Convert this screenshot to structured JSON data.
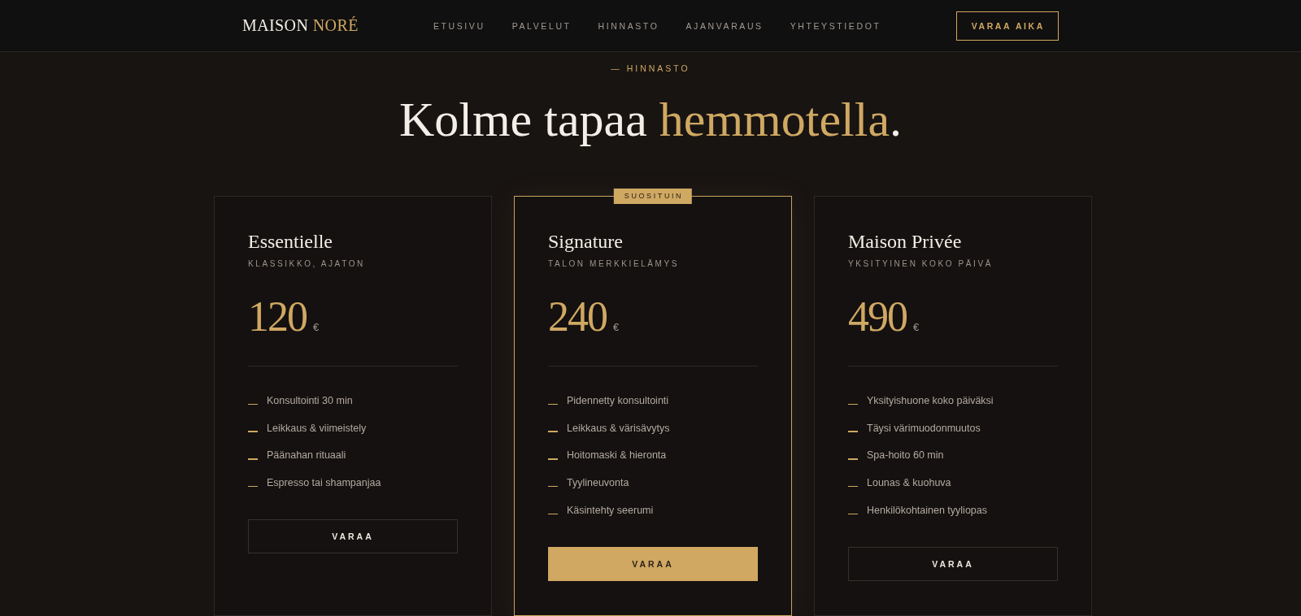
{
  "header": {
    "logo": {
      "text": "MAISON",
      "accent": "NORÉ"
    },
    "nav": [
      "ETUSIVU",
      "PALVELUT",
      "HINNASTO",
      "AJANVARAUS",
      "YHTEYSTIEDOT"
    ],
    "cta": "VARAA AIKA"
  },
  "pricing": {
    "eyebrow": "— HINNASTO",
    "heading": {
      "lead": "Kolme tapaa",
      "accent": "hemmotella",
      "tail": "."
    },
    "plans": [
      {
        "name": "Essentielle",
        "tagline": "KLASSIKKO, AJATON",
        "price": "120",
        "currency": "€",
        "features": [
          "Konsultointi 30 min",
          "Leikkaus & viimeistely",
          "Päänahan rituaali",
          "Espresso tai shampanjaa"
        ],
        "button": "VARAA",
        "featured": false
      },
      {
        "badge": "SUOSITUIN",
        "name": "Signature",
        "tagline": "TALON MERKKIELÄMYS",
        "price": "240",
        "currency": "€",
        "features": [
          "Pidennetty konsultointi",
          "Leikkaus & värisävytys",
          "Hoitomaski & hieronta",
          "Tyylineuvonta",
          "Käsintehty seerumi"
        ],
        "button": "VARAA",
        "featured": true
      },
      {
        "name": "Maison Privée",
        "tagline": "YKSITYINEN KOKO PÄIVÄ",
        "price": "490",
        "currency": "€",
        "features": [
          "Yksityishuone koko päiväksi",
          "Täysi värimuodonmuutos",
          "Spa-hoito 60 min",
          "Lounas & kuohuva",
          "Henkilökohtainen tyyliopas"
        ],
        "button": "VARAA",
        "featured": false
      }
    ]
  }
}
